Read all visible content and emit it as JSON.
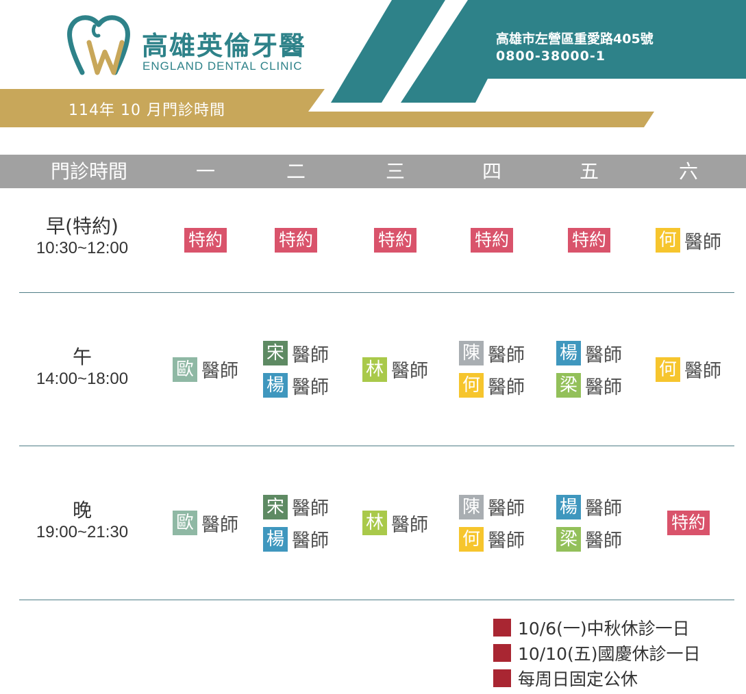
{
  "header": {
    "clinic_name_cn": "高雄英倫牙醫",
    "clinic_name_en": "ENGLAND DENTAL CLINIC",
    "schedule_title": "114年 10 月門診時間",
    "address": "高雄市左營區重愛路405號",
    "phone": "0800-38000-1"
  },
  "colors": {
    "teal": "#2e8289",
    "gold": "#c8a75a",
    "header_gray": "#a1a1a1",
    "special_pink": "#d9536b",
    "note_red": "#a92632"
  },
  "table": {
    "headers": [
      "門診時間",
      "一",
      "二",
      "三",
      "四",
      "五",
      "六"
    ],
    "slots": [
      {
        "name": "早(特約)",
        "time": "10:30~12:00"
      },
      {
        "name": "午",
        "time": "14:00~18:00"
      },
      {
        "name": "晚",
        "time": "19:00~21:30"
      }
    ],
    "special_label": "特約",
    "doctor_title": "醫師",
    "doctor_colors": {
      "何": "#f6c52d",
      "歐": "#8fb8a4",
      "宋": "#5e8a63",
      "楊": "#3f97be",
      "林": "#a9c94a",
      "陳": "#a9aeb2",
      "梁": "#93c05a"
    }
  },
  "notes": [
    "10/6(一)中秋休診一日",
    "10/10(五)國慶休診一日",
    "每周日固定公休"
  ]
}
